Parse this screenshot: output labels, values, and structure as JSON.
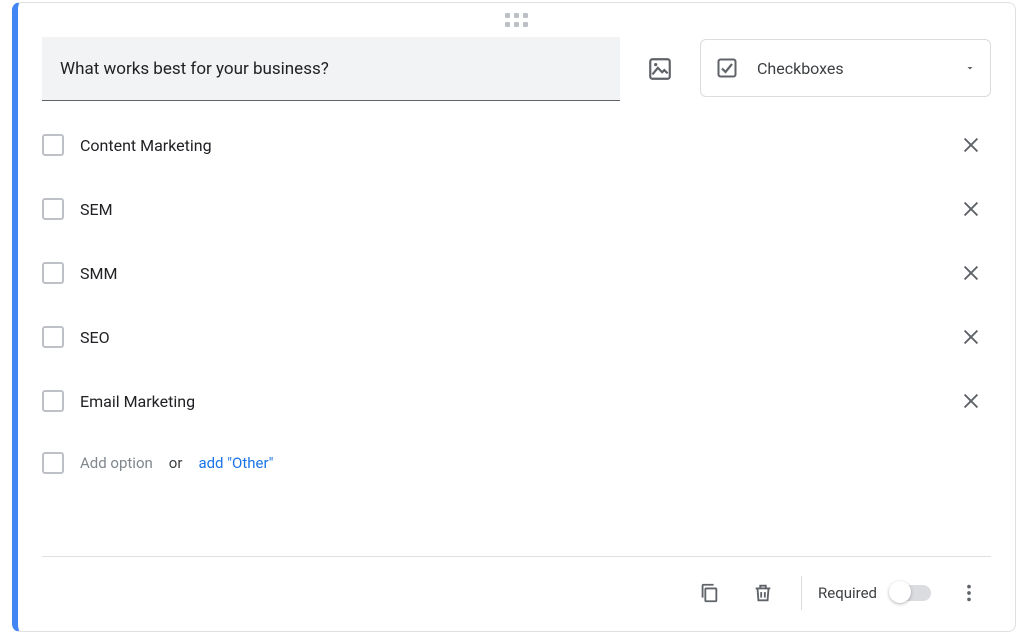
{
  "question": "What works best for your business?",
  "type_selector": {
    "label": "Checkboxes"
  },
  "options": [
    {
      "label": "Content Marketing"
    },
    {
      "label": "SEM"
    },
    {
      "label": "SMM"
    },
    {
      "label": "SEO"
    },
    {
      "label": "Email Marketing"
    }
  ],
  "add_option_placeholder": "Add option",
  "or_text": "or",
  "add_other_label": "add \"Other\"",
  "footer": {
    "required_label": "Required",
    "required_on": false
  }
}
